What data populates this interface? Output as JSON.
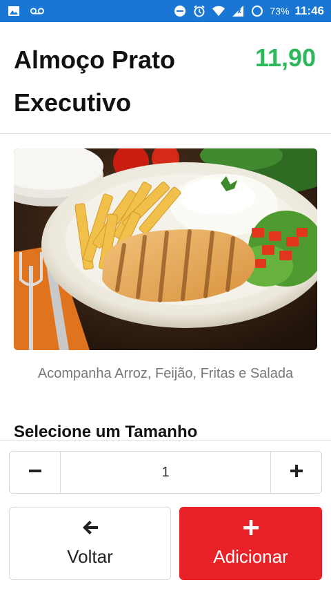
{
  "status_bar": {
    "battery": "73%",
    "time": "11:46",
    "icons": [
      "image-icon",
      "voicemail-icon",
      "do-not-disturb-icon",
      "alarm-icon",
      "wifi-icon",
      "signal-icon",
      "battery-icon"
    ]
  },
  "product": {
    "title": "Almoço Prato Executivo",
    "price": "11,90",
    "description": "Acompanha Arroz, Feijão, Fritas e Salada"
  },
  "size_section": {
    "title": "Selecione um Tamanho"
  },
  "quantity": {
    "value": "1"
  },
  "actions": {
    "back_label": "Voltar",
    "add_label": "Adicionar"
  },
  "colors": {
    "status_bar": "#1976d2",
    "price": "#2eb85c",
    "add_button": "#e92228"
  }
}
